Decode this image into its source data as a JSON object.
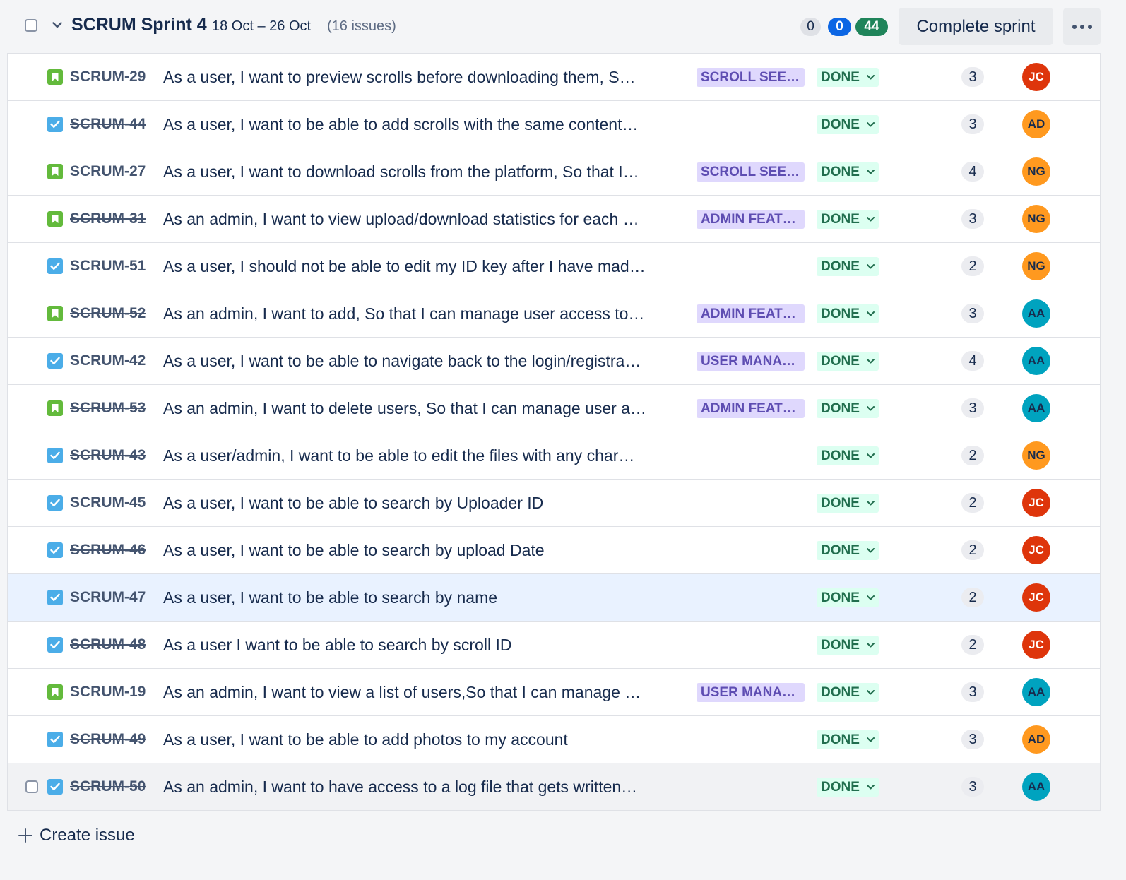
{
  "sprint": {
    "name": "SCRUM Sprint 4",
    "dates": "18 Oct – 26 Oct",
    "issue_count": "(16 issues)",
    "counts": {
      "todo": "0",
      "in_progress": "0",
      "done": "44"
    },
    "complete_label": "Complete sprint"
  },
  "colors": {
    "story": "#63ba3c",
    "task": "#4bade8",
    "epic_bg": "#dfd8fd",
    "epic_text": "#5e4db2",
    "done_bg": "#dcfff1",
    "done_text": "#216e4e",
    "avatar_JC": "#de350b",
    "avatar_AD": "#ff991f",
    "avatar_NG": "#ff991f",
    "avatar_AA": "#00a3bf"
  },
  "issues": [
    {
      "type": "story",
      "key": "SCRUM-29",
      "strike": false,
      "summary": "As a user, I want to preview scrolls before downloading them, S…",
      "epic": "SCROLL SEE…",
      "status": "DONE",
      "points": "3",
      "assignee": "JC"
    },
    {
      "type": "task",
      "key": "SCRUM-44",
      "strike": true,
      "summary": "As a user, I want to be able to add scrolls with the same content…",
      "epic": "",
      "status": "DONE",
      "points": "3",
      "assignee": "AD"
    },
    {
      "type": "story",
      "key": "SCRUM-27",
      "strike": false,
      "summary": "As a user, I want to download scrolls from the platform, So that I…",
      "epic": "SCROLL SEE…",
      "status": "DONE",
      "points": "4",
      "assignee": "NG"
    },
    {
      "type": "story",
      "key": "SCRUM-31",
      "strike": true,
      "summary": "As an admin, I want to view upload/download statistics for each …",
      "epic": "ADMIN FEAT…",
      "status": "DONE",
      "points": "3",
      "assignee": "NG"
    },
    {
      "type": "task",
      "key": "SCRUM-51",
      "strike": false,
      "summary": "As a user, I should not be able to edit my ID key after I have mad…",
      "epic": "",
      "status": "DONE",
      "points": "2",
      "assignee": "NG"
    },
    {
      "type": "story",
      "key": "SCRUM-52",
      "strike": true,
      "summary": "As an admin, I want to add, So that I can manage user access to…",
      "epic": "ADMIN FEAT…",
      "status": "DONE",
      "points": "3",
      "assignee": "AA"
    },
    {
      "type": "task",
      "key": "SCRUM-42",
      "strike": false,
      "summary": "As a user, I want to be able to navigate back to the login/registra…",
      "epic": "USER MANA…",
      "status": "DONE",
      "points": "4",
      "assignee": "AA"
    },
    {
      "type": "story",
      "key": "SCRUM-53",
      "strike": true,
      "summary": "As an admin, I want to delete users, So that I can manage user a…",
      "epic": "ADMIN FEAT…",
      "status": "DONE",
      "points": "3",
      "assignee": "AA"
    },
    {
      "type": "task",
      "key": "SCRUM-43",
      "strike": true,
      "summary": "As a user/admin, I want to be able to edit the files with any char…",
      "epic": "",
      "status": "DONE",
      "points": "2",
      "assignee": "NG"
    },
    {
      "type": "task",
      "key": "SCRUM-45",
      "strike": false,
      "summary": "As a user, I want to be able to search by Uploader ID",
      "epic": "",
      "status": "DONE",
      "points": "2",
      "assignee": "JC"
    },
    {
      "type": "task",
      "key": "SCRUM-46",
      "strike": true,
      "summary": "As a user, I want to be able to search by upload Date",
      "epic": "",
      "status": "DONE",
      "points": "2",
      "assignee": "JC"
    },
    {
      "type": "task",
      "key": "SCRUM-47",
      "strike": false,
      "summary": "As a user, I want to be able to search by name",
      "epic": "",
      "status": "DONE",
      "points": "2",
      "assignee": "JC"
    },
    {
      "type": "task",
      "key": "SCRUM-48",
      "strike": true,
      "summary": "As a user I want to be able to search by scroll ID",
      "epic": "",
      "status": "DONE",
      "points": "2",
      "assignee": "JC"
    },
    {
      "type": "story",
      "key": "SCRUM-19",
      "strike": false,
      "summary": "As an admin, I want to view a list of users,So that I can manage …",
      "epic": "USER MANA…",
      "status": "DONE",
      "points": "3",
      "assignee": "AA"
    },
    {
      "type": "task",
      "key": "SCRUM-49",
      "strike": true,
      "summary": "As a user, I want to be able to add photos to my account",
      "epic": "",
      "status": "DONE",
      "points": "3",
      "assignee": "AD"
    },
    {
      "type": "task",
      "key": "SCRUM-50",
      "strike": true,
      "summary": "As an admin, I want to have access to a log file that gets written…",
      "epic": "",
      "status": "DONE",
      "points": "3",
      "assignee": "AA"
    }
  ],
  "footer": {
    "create_label": "Create issue"
  }
}
